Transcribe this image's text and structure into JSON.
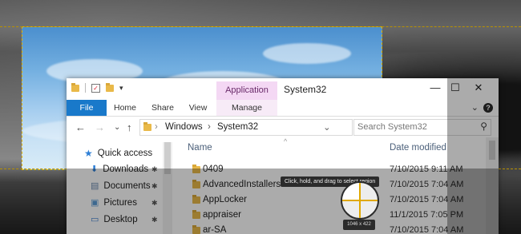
{
  "ribbon_quick_access": {
    "dropdown_glyph": "▾"
  },
  "window": {
    "context_tab": "Application Tools",
    "title": "System32",
    "controls": {
      "minimize": "—",
      "maximize": "☐",
      "close": "✕"
    }
  },
  "ribbon": {
    "tabs": [
      {
        "label": "File"
      },
      {
        "label": "Home"
      },
      {
        "label": "Share"
      },
      {
        "label": "View"
      },
      {
        "label": "Manage"
      }
    ],
    "collapse_glyph": "⌄",
    "help_glyph": "?"
  },
  "address": {
    "back": "←",
    "forward": "→",
    "recent": "⌄",
    "up": "↑",
    "path": [
      "Windows",
      "System32"
    ],
    "separator": "›",
    "refresh": "↻"
  },
  "search": {
    "placeholder": "Search System32",
    "icon": "search-icon"
  },
  "nav_pane": {
    "items": [
      {
        "label": "Quick access",
        "icon": "star-icon"
      },
      {
        "label": "Downloads",
        "icon": "download-icon",
        "pinned": true
      },
      {
        "label": "Documents",
        "icon": "documents-icon",
        "pinned": true
      },
      {
        "label": "Pictures",
        "icon": "pictures-icon",
        "pinned": true
      },
      {
        "label": "Desktop",
        "icon": "desktop-icon",
        "pinned": true
      }
    ],
    "pin_glyph": "✱"
  },
  "file_list": {
    "columns": {
      "name": "Name",
      "date": "Date modified"
    },
    "rows": [
      {
        "name": "0409",
        "date": "7/10/2015 9:11 AM"
      },
      {
        "name": "AdvancedInstallers",
        "date": "7/10/2015 7:04 AM"
      },
      {
        "name": "AppLocker",
        "date": "7/10/2015 7:04 AM"
      },
      {
        "name": "appraiser",
        "date": "11/1/2015 7:05 PM"
      },
      {
        "name": "ar-SA",
        "date": "7/10/2015 7:04 AM"
      }
    ]
  },
  "snip_overlay": {
    "hint": "Click, hold, and drag to select region",
    "magnifier_readout": "1046 x 422"
  },
  "colors": {
    "accent": "#1979ca",
    "selection_border": "#e2b400",
    "context_tab": "#f4d8f4"
  }
}
